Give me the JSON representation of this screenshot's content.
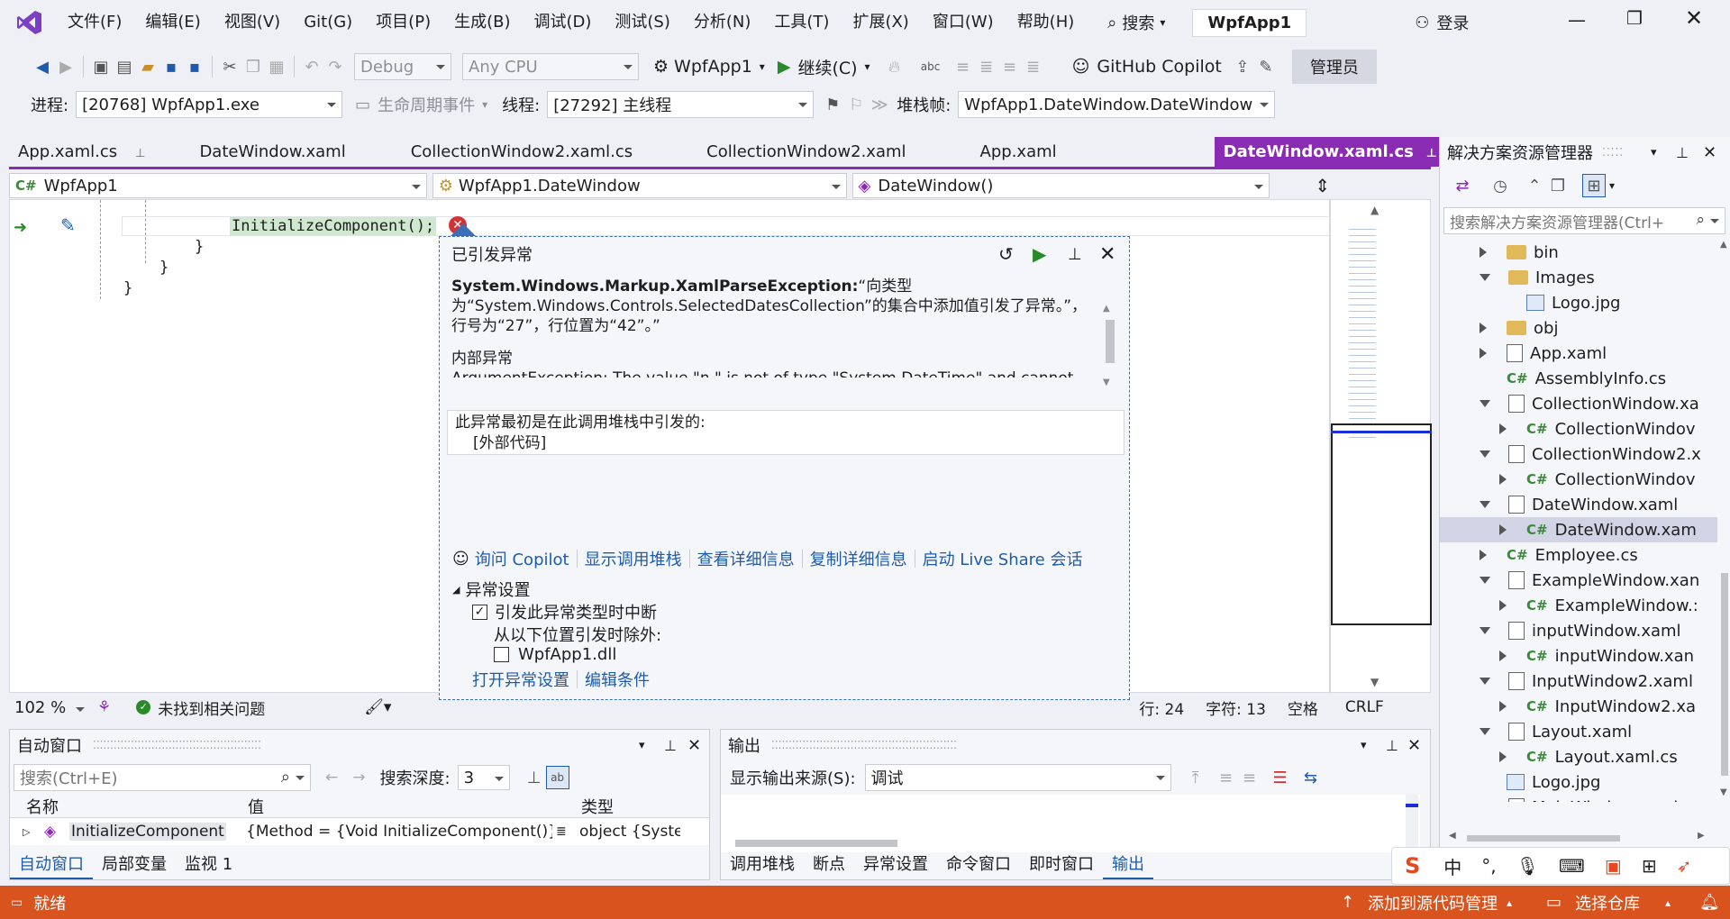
{
  "titlebar": {
    "menu": [
      "文件(F)",
      "编辑(E)",
      "视图(V)",
      "Git(G)",
      "项目(P)",
      "生成(B)",
      "调试(D)",
      "测试(S)",
      "分析(N)",
      "工具(T)",
      "扩展(X)",
      "窗口(W)",
      "帮助(H)"
    ],
    "search_label": "搜索",
    "app_name": "WpfApp1",
    "login": "登录"
  },
  "toolbar": {
    "config": "Debug",
    "platform": "Any CPU",
    "project": "WpfApp1",
    "continue": "继续(C)",
    "copilot": "GitHub Copilot",
    "admin": "管理员"
  },
  "debugbar": {
    "process_label": "进程:",
    "process": "[20768] WpfApp1.exe",
    "lifecycle": "生命周期事件",
    "thread_label": "线程:",
    "thread": "[27292] 主线程",
    "stack_label": "堆栈帧:",
    "stack": "WpfApp1.DateWindow.DateWindow"
  },
  "tabs": [
    "App.xaml.cs",
    "DateWindow.xaml",
    "CollectionWindow2.xaml.cs",
    "CollectionWindow2.xaml",
    "App.xaml",
    "DateWindow.xaml.cs"
  ],
  "nav": {
    "project": "WpfApp1",
    "class": "WpfApp1.DateWindow",
    "member": "DateWindow()"
  },
  "editor": {
    "code_line": "InitializeComponent();",
    "close_brace1": "}",
    "close_brace2": "}",
    "zoom": "102 %",
    "issues": "未找到相关问题",
    "line": "行: 24",
    "char": "字符: 13",
    "space": "空格",
    "eol": "CRLF"
  },
  "exception": {
    "title": "已引发异常",
    "type": "System.Windows.Markup.XamlParseException:",
    "message": "“向类型为“System.Windows.Controls.SelectedDatesCollection”的集合中添加值引发了异常。”，行号为“27”，行位置为“42”。”",
    "inner_label": "内部异常",
    "inner_text": "ArgumentException: The value \"n \" is not of type \"System.DateTime\" and cannot",
    "stack_origin": "此异常最初是在此调用堆栈中引发的:",
    "external_code": "[外部代码]",
    "links": [
      "询问 Copilot",
      "显示调用堆栈",
      "查看详细信息",
      "复制详细信息",
      "启动 Live Share 会话"
    ],
    "settings_label": "异常设置",
    "break_when_thrown": "引发此异常类型时中断",
    "except_from": "从以下位置引发时除外:",
    "dll": "WpfApp1.dll",
    "open_settings": "打开异常设置",
    "edit_conditions": "编辑条件"
  },
  "solution_explorer": {
    "title": "解决方案资源管理器",
    "search_placeholder": "搜索解决方案资源管理器(Ctrl+",
    "items": [
      {
        "label": "bin",
        "kind": "folder",
        "indent": 1,
        "state": "collapsed"
      },
      {
        "label": "Images",
        "kind": "folder",
        "indent": 1,
        "state": "expanded"
      },
      {
        "label": "Logo.jpg",
        "kind": "image",
        "indent": 2,
        "state": "none"
      },
      {
        "label": "obj",
        "kind": "folder",
        "indent": 1,
        "state": "collapsed"
      },
      {
        "label": "App.xaml",
        "kind": "file",
        "indent": 1,
        "state": "collapsed"
      },
      {
        "label": "AssemblyInfo.cs",
        "kind": "cs",
        "indent": 1,
        "state": "none"
      },
      {
        "label": "CollectionWindow.xa",
        "kind": "file",
        "indent": 1,
        "state": "expanded"
      },
      {
        "label": "CollectionWindov",
        "kind": "cs",
        "indent": 2,
        "state": "collapsed"
      },
      {
        "label": "CollectionWindow2.x",
        "kind": "file",
        "indent": 1,
        "state": "expanded"
      },
      {
        "label": "CollectionWindov",
        "kind": "cs",
        "indent": 2,
        "state": "collapsed"
      },
      {
        "label": "DateWindow.xaml",
        "kind": "file",
        "indent": 1,
        "state": "expanded"
      },
      {
        "label": "DateWindow.xam",
        "kind": "cs",
        "indent": 2,
        "state": "collapsed",
        "selected": true
      },
      {
        "label": "Employee.cs",
        "kind": "cs",
        "indent": 1,
        "state": "collapsed"
      },
      {
        "label": "ExampleWindow.xan",
        "kind": "file",
        "indent": 1,
        "state": "expanded"
      },
      {
        "label": "ExampleWindow.:",
        "kind": "cs",
        "indent": 2,
        "state": "collapsed"
      },
      {
        "label": "inputWindow.xaml",
        "kind": "file",
        "indent": 1,
        "state": "expanded"
      },
      {
        "label": "inputWindow.xan",
        "kind": "cs",
        "indent": 2,
        "state": "collapsed"
      },
      {
        "label": "InputWindow2.xaml",
        "kind": "file",
        "indent": 1,
        "state": "expanded"
      },
      {
        "label": "InputWindow2.xa",
        "kind": "cs",
        "indent": 2,
        "state": "collapsed"
      },
      {
        "label": "Layout.xaml",
        "kind": "file",
        "indent": 1,
        "state": "expanded"
      },
      {
        "label": "Layout.xaml.cs",
        "kind": "cs",
        "indent": 2,
        "state": "collapsed"
      },
      {
        "label": "Logo.jpg",
        "kind": "image",
        "indent": 1,
        "state": "none"
      },
      {
        "label": "MainWindow.xaml",
        "kind": "file",
        "indent": 1,
        "state": "expanded"
      }
    ]
  },
  "autos": {
    "title": "自动窗口",
    "search_placeholder": "搜索(Ctrl+E)",
    "depth_label": "搜索深度:",
    "depth": "3",
    "cols": [
      "名称",
      "值",
      "类型"
    ],
    "row": {
      "name": "InitializeComponent",
      "value": "{Method = {Void InitializeComponent()}}",
      "type": "object {Syste..."
    },
    "tabs": [
      "自动窗口",
      "局部变量",
      "监视 1"
    ]
  },
  "output": {
    "title": "输出",
    "source_label": "显示输出来源(S):",
    "source": "调试",
    "tabs": [
      "调用堆栈",
      "断点",
      "异常设置",
      "命令窗口",
      "即时窗口",
      "输出"
    ]
  },
  "ime": {
    "lang": "中"
  },
  "statusbar": {
    "ready": "就绪",
    "source_control": "添加到源代码管理",
    "repo": "选择仓库"
  },
  "colors": {
    "accent": "#8a2bb3",
    "status": "#d9531e",
    "link": "#1f5bab"
  }
}
